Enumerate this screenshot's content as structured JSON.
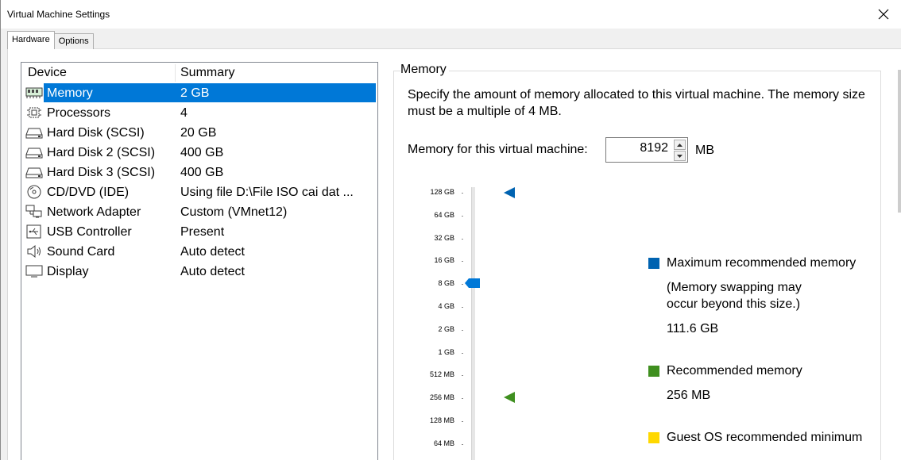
{
  "window": {
    "title": "Virtual Machine Settings"
  },
  "tabs": [
    {
      "label": "Hardware",
      "active": true
    },
    {
      "label": "Options",
      "active": false
    }
  ],
  "device_list": {
    "columns": {
      "device": "Device",
      "summary": "Summary"
    },
    "rows": [
      {
        "icon": "memory-icon",
        "device": "Memory",
        "summary": "2 GB",
        "selected": true
      },
      {
        "icon": "processor-icon",
        "device": "Processors",
        "summary": "4"
      },
      {
        "icon": "hard-disk-icon",
        "device": "Hard Disk (SCSI)",
        "summary": "20 GB"
      },
      {
        "icon": "hard-disk-icon",
        "device": "Hard Disk 2 (SCSI)",
        "summary": "400 GB"
      },
      {
        "icon": "hard-disk-icon",
        "device": "Hard Disk 3 (SCSI)",
        "summary": "400 GB"
      },
      {
        "icon": "cd-dvd-icon",
        "device": "CD/DVD (IDE)",
        "summary": "Using file D:\\File ISO cai dat ..."
      },
      {
        "icon": "network-adapter-icon",
        "device": "Network Adapter",
        "summary": "Custom (VMnet12)"
      },
      {
        "icon": "usb-icon",
        "device": "USB Controller",
        "summary": "Present"
      },
      {
        "icon": "sound-card-icon",
        "device": "Sound Card",
        "summary": "Auto detect"
      },
      {
        "icon": "display-icon",
        "device": "Display",
        "summary": "Auto detect"
      }
    ]
  },
  "memory": {
    "group_label": "Memory",
    "description": "Specify the amount of memory allocated to this virtual machine. The memory size must be a multiple of 4 MB.",
    "field_label": "Memory for this virtual machine:",
    "value": "8192",
    "unit": "MB",
    "slider": {
      "ticks": [
        "128 GB",
        "64 GB",
        "32 GB",
        "16 GB",
        "8 GB",
        "4 GB",
        "2 GB",
        "1 GB",
        "512 MB",
        "256 MB",
        "128 MB",
        "64 MB"
      ],
      "selected": "8 GB"
    },
    "legend": {
      "max": {
        "label": "Maximum recommended memory",
        "note_line1": "(Memory swapping may",
        "note_line2": "occur beyond this size.)",
        "value": "111.6 GB",
        "color": "#0063b1"
      },
      "recommended": {
        "label": "Recommended memory",
        "value": "256 MB",
        "color": "#3f8f1f"
      },
      "guest_min": {
        "label": "Guest OS recommended minimum",
        "color": "#ffd800"
      }
    }
  },
  "colors": {
    "selection": "#0078d7"
  }
}
